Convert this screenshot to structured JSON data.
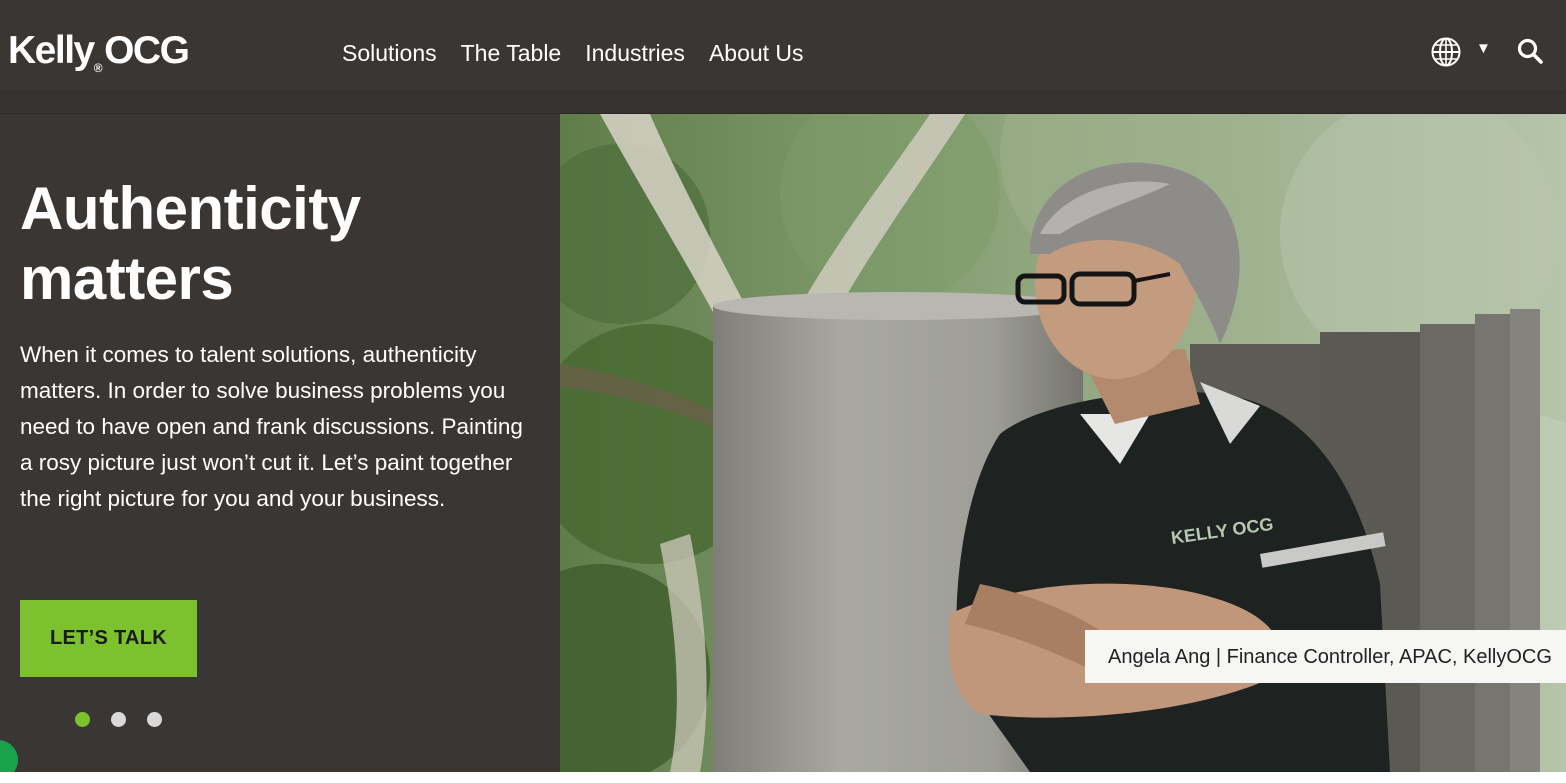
{
  "brand": {
    "name": "Kelly",
    "name2": "OCG",
    "mark": "®"
  },
  "nav": {
    "items": [
      {
        "label": "Solutions"
      },
      {
        "label": "The Table"
      },
      {
        "label": "Industries"
      },
      {
        "label": "About Us"
      }
    ],
    "language_icon": "globe-icon",
    "caret": "▼",
    "search_icon": "search-icon"
  },
  "hero": {
    "headline_line1": "Authenticity",
    "headline_line2": "matters",
    "body": "When it comes to talent solutions, authenticity matters. In order to solve business problems you need to have open and frank discussions. Painting a rosy picture just won’t cut it. Let’s paint together the right picture for you and your business.",
    "cta_label": "LET’S TALK",
    "caption": "Angela Ang | Finance Controller, APAC, KellyOCG",
    "photo_shirt_logo": "KELLY OCG",
    "slides": {
      "count": 3,
      "active_index": 0
    }
  },
  "colors": {
    "header_bg": "#3a3634",
    "accent_green": "#7cc12e",
    "dot_inactive": "#d9d9d9",
    "chat_badge": "#18a34a"
  }
}
